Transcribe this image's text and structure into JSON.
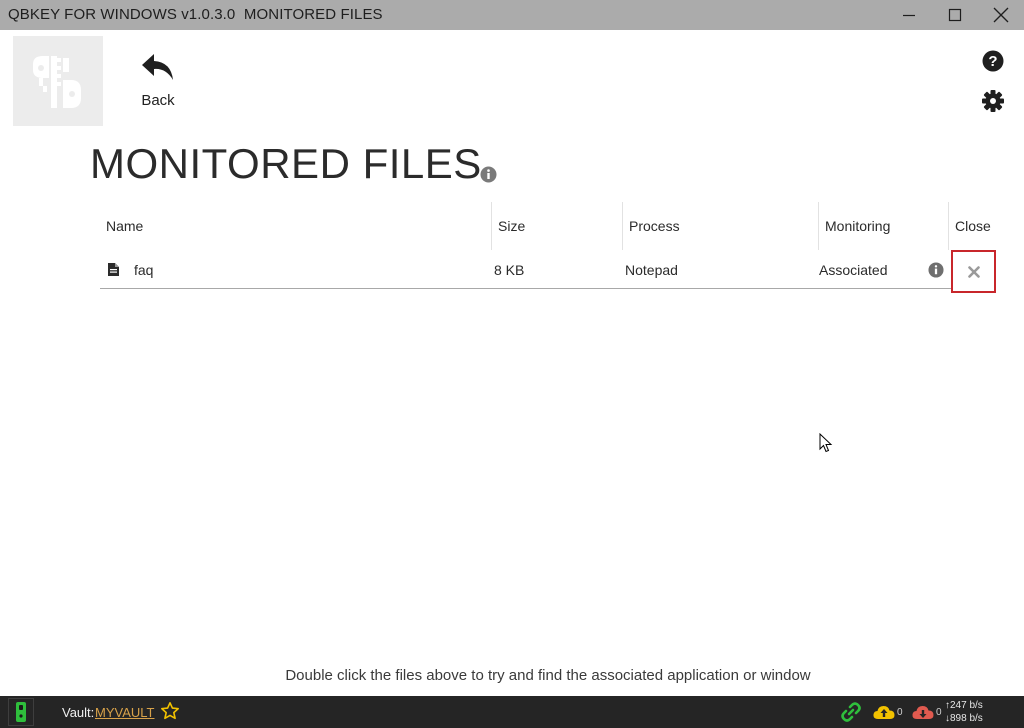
{
  "window": {
    "title": "QBKEY FOR WINDOWS v1.0.3.0  MONITORED FILES",
    "minimize_icon": "minimize-icon",
    "maximize_icon": "maximize-icon",
    "close_icon": "close-icon"
  },
  "header": {
    "back_label": "Back",
    "help_icon": "help-icon",
    "settings_icon": "gear-icon"
  },
  "page": {
    "title": "MONITORED FILES"
  },
  "table": {
    "columns": [
      "Name",
      "Size",
      "Process",
      "Monitoring",
      "Close"
    ],
    "rows": [
      {
        "name": "faq",
        "size": "8 KB",
        "process": "Notepad",
        "monitoring": "Associated"
      }
    ]
  },
  "footer": {
    "hint": "Double click the files above to try and find the associated application or window"
  },
  "statusbar": {
    "vault_label": "Vault:",
    "vault_name": "MYVAULT",
    "upload_count": "0",
    "download_count": "0",
    "upload_rate": "247 b/s",
    "download_rate": "898 b/s"
  },
  "colors": {
    "titlebar": "#ababab",
    "statusbar": "#252525",
    "vault_link": "#d8a24a",
    "close_highlight": "#c8262b",
    "indicator_green": "#2fbf3c",
    "cloud_yellow": "#f2c200",
    "cloud_red": "#e05a4f"
  }
}
